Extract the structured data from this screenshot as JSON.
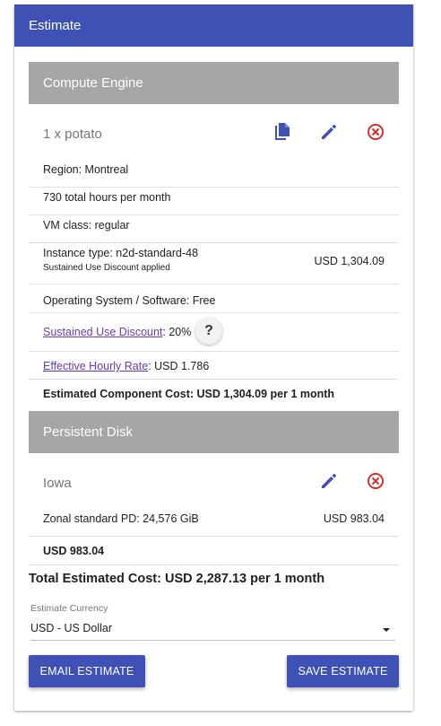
{
  "header": {
    "title": "Estimate"
  },
  "compute": {
    "section_title": "Compute Engine",
    "item_title": "1 x potato",
    "rows": {
      "region": "Region: Montreal",
      "hours": "730 total hours per month",
      "vm_class": "VM class: regular",
      "instance_type": "Instance type: n2d-standard-48",
      "instance_sub": "Sustained Use Discount applied",
      "instance_price": "USD 1,304.09",
      "os": "Operating System / Software: Free",
      "sud_link": "Sustained Use Discount",
      "sud_value": ": 20%",
      "help_label": "?",
      "ehr_link": "Effective Hourly Rate",
      "ehr_value": ": USD 1.786",
      "component_cost": "Estimated Component Cost: USD 1,304.09 per 1 month"
    }
  },
  "disk": {
    "section_title": "Persistent Disk",
    "item_title": "Iowa",
    "rows": {
      "zonal": "Zonal standard PD: 24,576 GiB",
      "zonal_price": "USD 983.04",
      "subtotal": "USD 983.04"
    }
  },
  "total": "Total Estimated Cost: USD 2,287.13 per 1 month",
  "currency": {
    "label": "Estimate Currency",
    "selected": "USD - US Dollar"
  },
  "buttons": {
    "email": "EMAIL ESTIMATE",
    "save": "SAVE ESTIMATE"
  },
  "colors": {
    "primary": "#3f51b5",
    "section_gray": "#a6a6a6",
    "delete_red": "#d32f2f",
    "link_purple": "#673ab7"
  },
  "icons": [
    "copy-icon",
    "edit-icon",
    "delete-icon"
  ]
}
